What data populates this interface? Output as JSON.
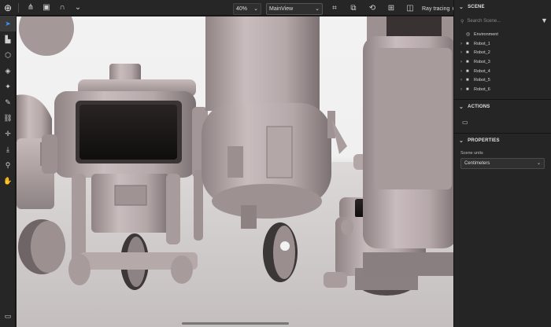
{
  "toolbar_top": {
    "zoom_value": "40%",
    "view_select_value": "MainView",
    "ray_tracing_label": "Ray tracing"
  },
  "panel": {
    "scene": {
      "title": "SCENE",
      "search_placeholder": "Search Scene...",
      "items": [
        {
          "label": "Environment",
          "type": "environment"
        },
        {
          "label": "Robot_1",
          "type": "folder"
        },
        {
          "label": "Robot_2",
          "type": "folder"
        },
        {
          "label": "Robot_3",
          "type": "folder"
        },
        {
          "label": "Robot_4",
          "type": "folder"
        },
        {
          "label": "Robot_5",
          "type": "folder"
        },
        {
          "label": "Robot_6",
          "type": "folder"
        }
      ]
    },
    "actions": {
      "title": "ACTIONS"
    },
    "properties": {
      "title": "PROPERTIES",
      "scene_units_label": "Scene units",
      "scene_units_value": "Centimeters"
    }
  }
}
